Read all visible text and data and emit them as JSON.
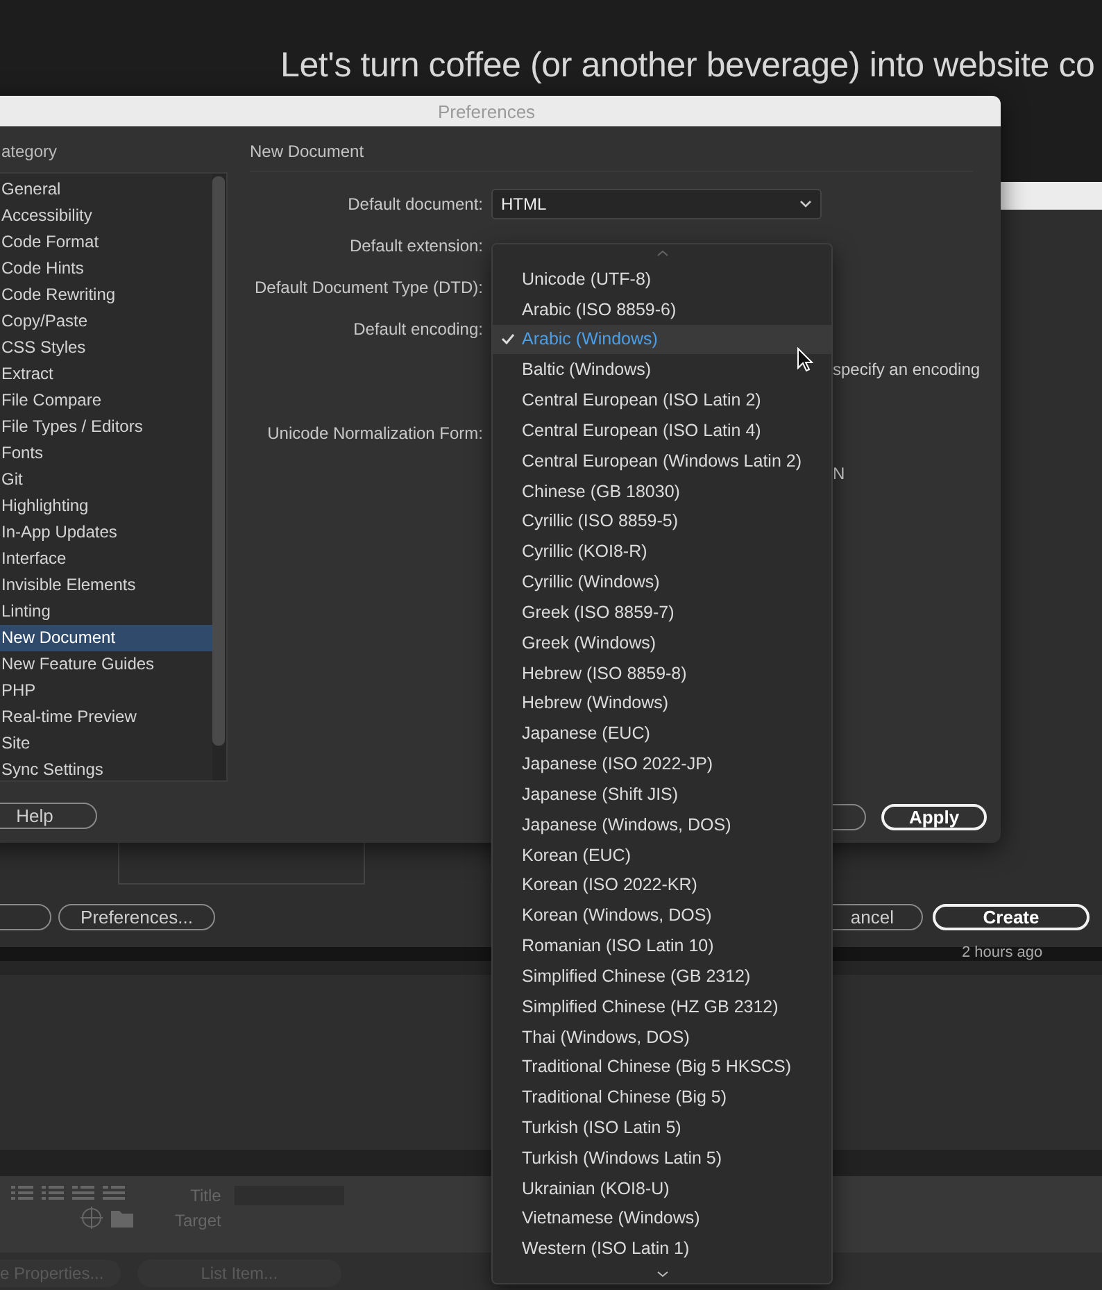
{
  "headline": "Let's turn coffee (or another beverage) into website co",
  "background": {
    "left_buttons": [
      "Preferences..."
    ],
    "right_buttons": [
      {
        "label": "ancel",
        "primary": false
      },
      {
        "label": "Create",
        "primary": true
      }
    ],
    "time": "2 hours ago",
    "property_labels": [
      "Title",
      "Target"
    ],
    "bottom_buttons": [
      "e Properties...",
      "List Item..."
    ]
  },
  "preferences": {
    "title": "Preferences",
    "category_label": "ategory",
    "categories": [
      {
        "label": "General",
        "selected": false
      },
      {
        "label": "Accessibility",
        "selected": false
      },
      {
        "label": "Code Format",
        "selected": false
      },
      {
        "label": "Code Hints",
        "selected": false
      },
      {
        "label": "Code Rewriting",
        "selected": false
      },
      {
        "label": "Copy/Paste",
        "selected": false
      },
      {
        "label": "CSS Styles",
        "selected": false
      },
      {
        "label": "Extract",
        "selected": false
      },
      {
        "label": "File Compare",
        "selected": false
      },
      {
        "label": "File Types / Editors",
        "selected": false
      },
      {
        "label": "Fonts",
        "selected": false
      },
      {
        "label": "Git",
        "selected": false
      },
      {
        "label": "Highlighting",
        "selected": false
      },
      {
        "label": "In-App Updates",
        "selected": false
      },
      {
        "label": "Interface",
        "selected": false
      },
      {
        "label": "Invisible Elements",
        "selected": false
      },
      {
        "label": "Linting",
        "selected": false
      },
      {
        "label": "New Document",
        "selected": true
      },
      {
        "label": "New Feature Guides",
        "selected": false
      },
      {
        "label": "PHP",
        "selected": false
      },
      {
        "label": "Real-time Preview",
        "selected": false
      },
      {
        "label": "Site",
        "selected": false
      },
      {
        "label": "Sync Settings",
        "selected": false
      }
    ],
    "section_title": "New Document",
    "rows": [
      {
        "kind": "select",
        "label": "Default document:",
        "value": "HTML"
      },
      {
        "kind": "label",
        "label": "Default extension:"
      },
      {
        "kind": "label",
        "label": "Default Document Type (DTD):"
      },
      {
        "kind": "label",
        "label": "Default encoding:"
      },
      {
        "kind": "note",
        "text": "specify an encoding"
      },
      {
        "kind": "label",
        "label": "Unicode Normalization Form:"
      },
      {
        "kind": "note",
        "text": "N"
      }
    ],
    "help_button": "Help",
    "apply_button": "Apply"
  },
  "encoding_menu": {
    "items": [
      {
        "label": "Unicode (UTF-8)",
        "selected": false
      },
      {
        "label": "Arabic (ISO 8859-6)",
        "selected": false
      },
      {
        "label": "Arabic (Windows)",
        "selected": true
      },
      {
        "label": "Baltic (Windows)",
        "selected": false
      },
      {
        "label": "Central European (ISO Latin 2)",
        "selected": false
      },
      {
        "label": "Central European (ISO Latin 4)",
        "selected": false
      },
      {
        "label": "Central European (Windows Latin 2)",
        "selected": false
      },
      {
        "label": "Chinese (GB 18030)",
        "selected": false
      },
      {
        "label": "Cyrillic (ISO 8859-5)",
        "selected": false
      },
      {
        "label": "Cyrillic (KOI8-R)",
        "selected": false
      },
      {
        "label": "Cyrillic (Windows)",
        "selected": false
      },
      {
        "label": "Greek (ISO 8859-7)",
        "selected": false
      },
      {
        "label": "Greek (Windows)",
        "selected": false
      },
      {
        "label": "Hebrew (ISO 8859-8)",
        "selected": false
      },
      {
        "label": "Hebrew (Windows)",
        "selected": false
      },
      {
        "label": "Japanese (EUC)",
        "selected": false
      },
      {
        "label": "Japanese (ISO 2022-JP)",
        "selected": false
      },
      {
        "label": "Japanese (Shift JIS)",
        "selected": false
      },
      {
        "label": "Japanese (Windows, DOS)",
        "selected": false
      },
      {
        "label": "Korean (EUC)",
        "selected": false
      },
      {
        "label": "Korean (ISO 2022-KR)",
        "selected": false
      },
      {
        "label": "Korean (Windows, DOS)",
        "selected": false
      },
      {
        "label": "Romanian (ISO Latin 10)",
        "selected": false
      },
      {
        "label": "Simplified Chinese (GB 2312)",
        "selected": false
      },
      {
        "label": "Simplified Chinese (HZ GB 2312)",
        "selected": false
      },
      {
        "label": "Thai (Windows, DOS)",
        "selected": false
      },
      {
        "label": "Traditional Chinese (Big 5 HKSCS)",
        "selected": false
      },
      {
        "label": "Traditional Chinese (Big 5)",
        "selected": false
      },
      {
        "label": "Turkish (ISO Latin 5)",
        "selected": false
      },
      {
        "label": "Turkish (Windows Latin 5)",
        "selected": false
      },
      {
        "label": "Ukrainian (KOI8-U)",
        "selected": false
      },
      {
        "label": "Vietnamese (Windows)",
        "selected": false
      },
      {
        "label": "Western (ISO Latin 1)",
        "selected": false
      }
    ]
  }
}
